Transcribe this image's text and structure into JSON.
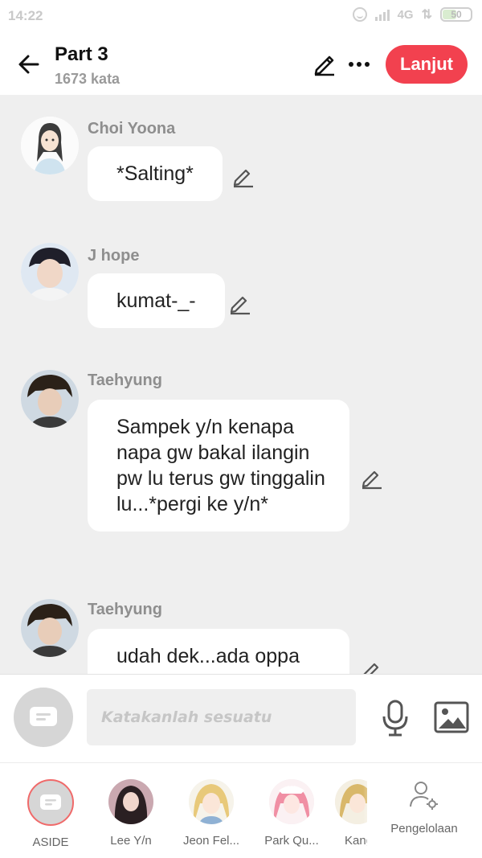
{
  "status_bar": {
    "time": "14:22",
    "network": "4G",
    "battery": "50",
    "battery_level": 0.5
  },
  "header": {
    "back_icon": "arrow-left-icon",
    "title": "Part 3",
    "subtitle": "1673 kata",
    "edit_icon": "pencil-icon",
    "more_icon": "more-dots-icon",
    "next_label": "Lanjut",
    "accent_color": "#f2414f"
  },
  "messages": [
    {
      "speaker": "Choi Yoona",
      "text": "*Salting*"
    },
    {
      "speaker": "J hope",
      "text": "kumat-_-"
    },
    {
      "speaker": "Taehyung",
      "text": "Sampek y/n kenapa napa gw bakal ilangin pw lu terus gw tinggalin lu...*pergi ke y/n*"
    },
    {
      "speaker": "Taehyung",
      "text": "udah dek...ada oppa"
    }
  ],
  "composer": {
    "placeholder": "Katakanlah sesuatu",
    "mic_icon": "microphone-icon",
    "image_icon": "image-icon"
  },
  "characters": [
    {
      "label": "ASIDE",
      "selected": true
    },
    {
      "label": "Lee Y/n"
    },
    {
      "label": "Jeon Fel..."
    },
    {
      "label": "Park Qu..."
    },
    {
      "label": "Kang"
    }
  ],
  "manage_label": "Pengelolaan"
}
